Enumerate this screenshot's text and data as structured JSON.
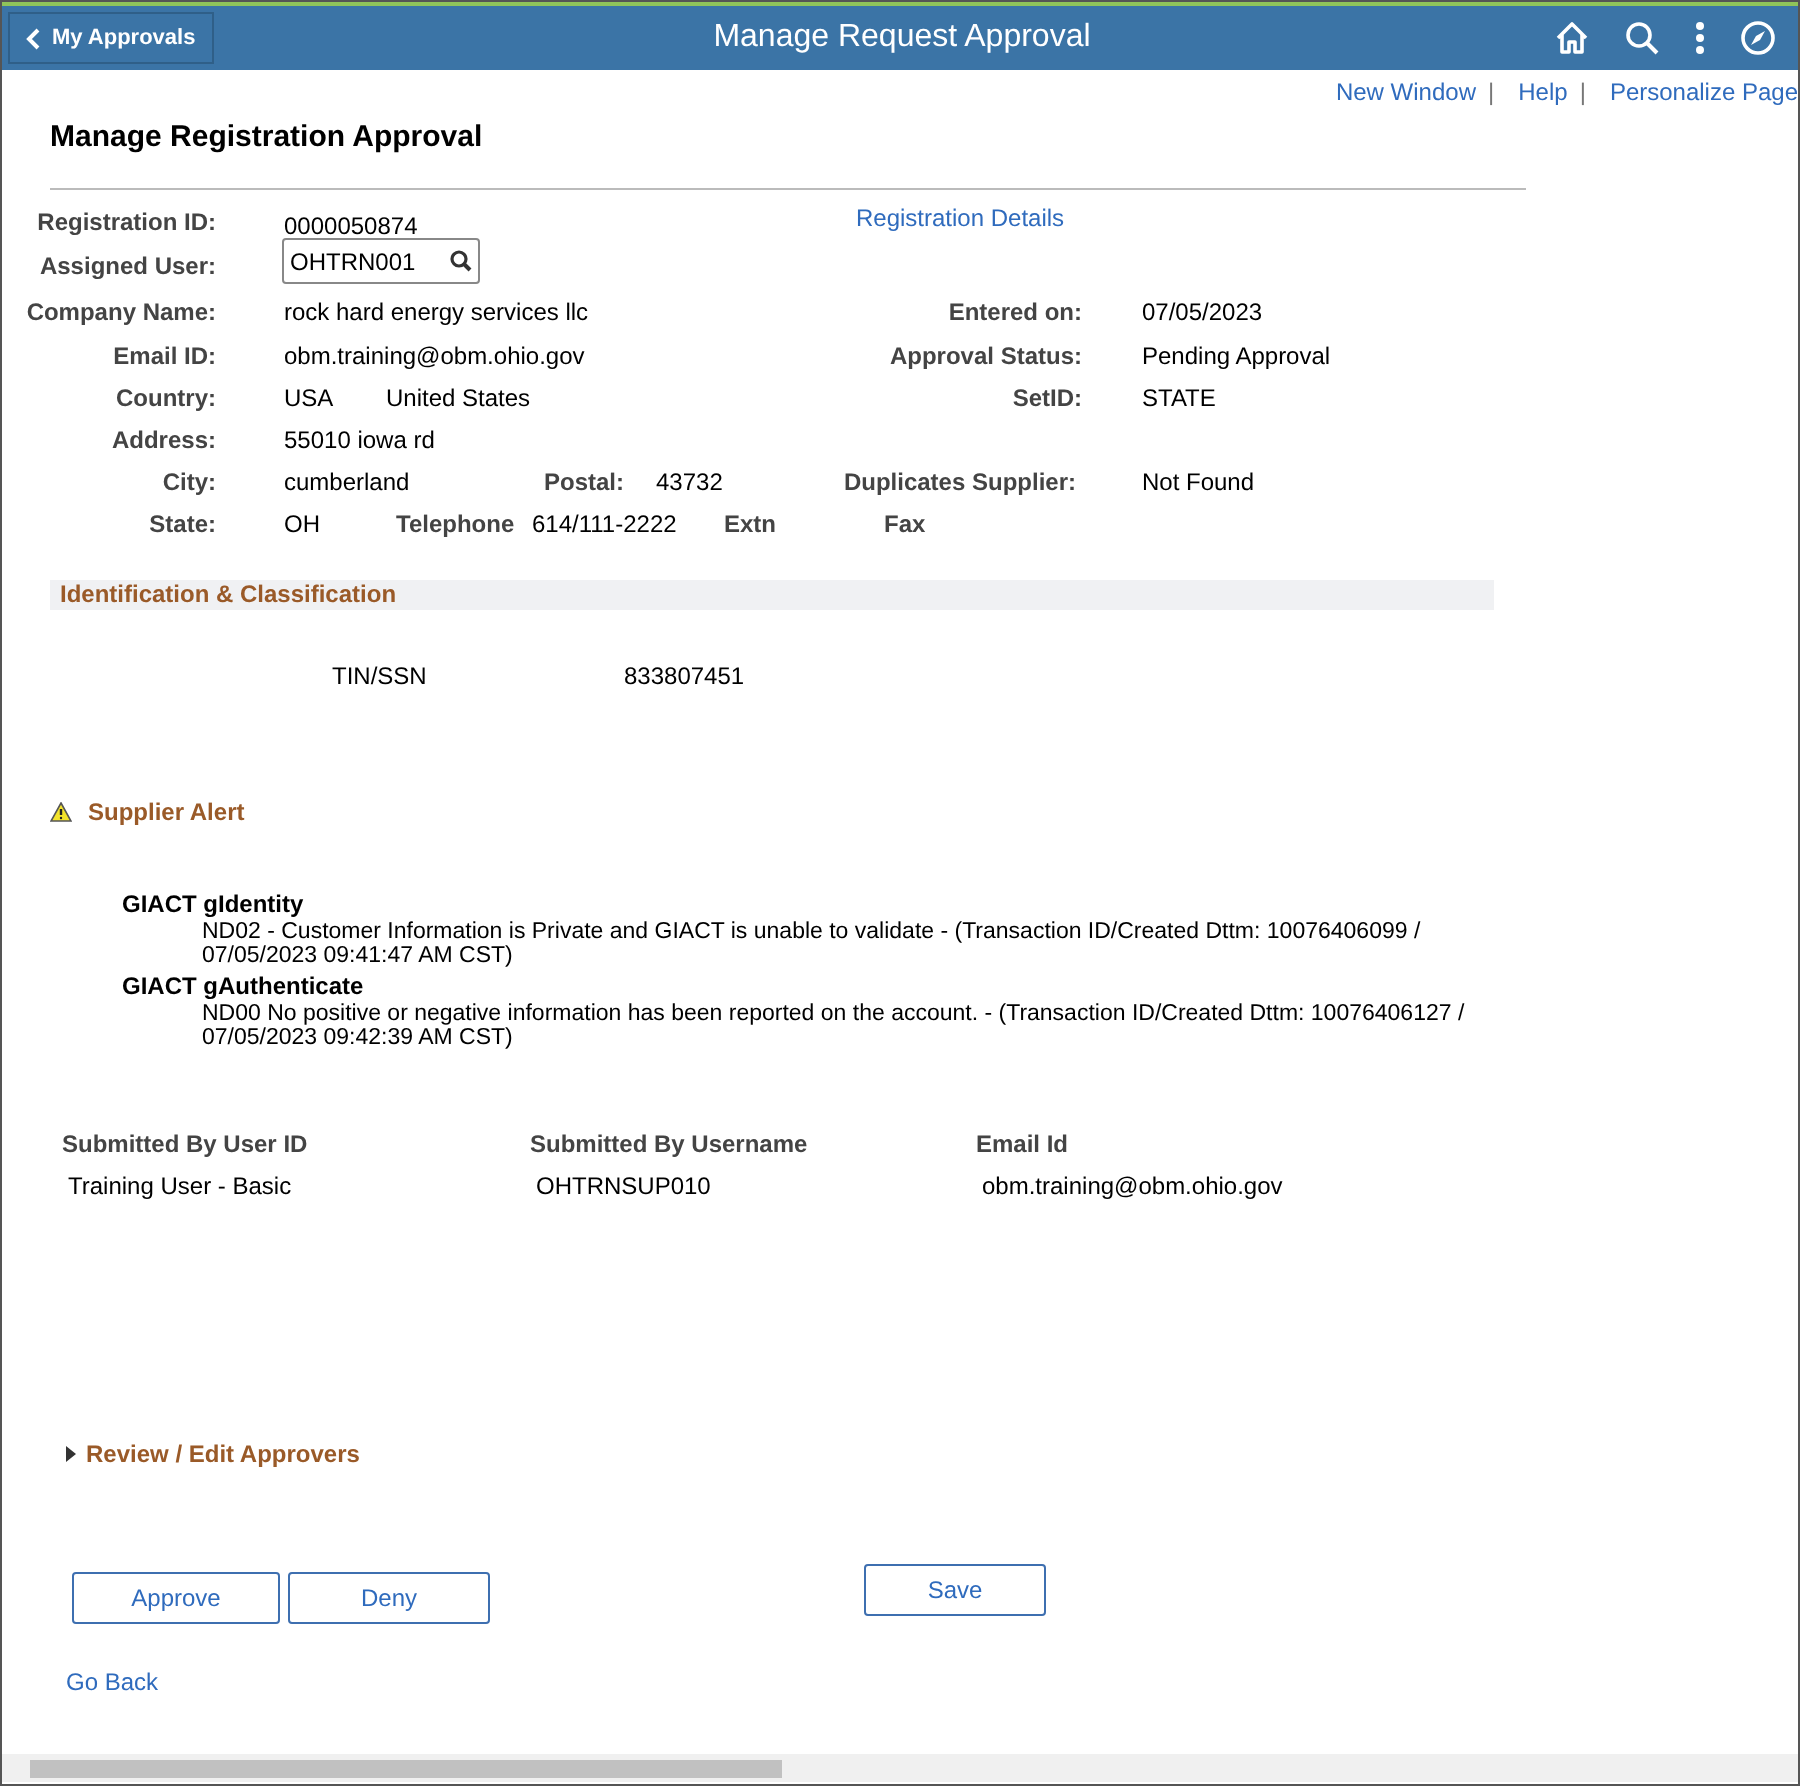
{
  "header": {
    "back_label": "My Approvals",
    "title": "Manage Request Approval"
  },
  "top_links": [
    {
      "label": "New Window",
      "separator": "|"
    },
    {
      "label": "Help",
      "separator": "|"
    },
    {
      "label": "Personalize Page"
    }
  ],
  "page_title": "Manage Registration Approval",
  "details": {
    "registration_id": {
      "label": "Registration ID:",
      "value": "0000050874"
    },
    "registration_details_link": "Registration Details",
    "assigned_user": {
      "label": "Assigned User:",
      "value": "OHTRN001"
    },
    "company_name": {
      "label": "Company Name:",
      "value": "rock hard energy services llc"
    },
    "entered_on": {
      "label": "Entered on:",
      "value": "07/05/2023"
    },
    "email_id": {
      "label": "Email ID:",
      "value": "obm.training@obm.ohio.gov"
    },
    "approval_status": {
      "label": "Approval Status:",
      "value": "Pending Approval"
    },
    "country": {
      "label": "Country:",
      "code": "USA",
      "name": "United States"
    },
    "setid": {
      "label": "SetID:",
      "value": "STATE"
    },
    "address": {
      "label": "Address:",
      "value": "55010 iowa rd"
    },
    "city": {
      "label": "City:",
      "value": "cumberland"
    },
    "postal": {
      "label": "Postal:",
      "value": "43732"
    },
    "duplicates_supplier": {
      "label": "Duplicates Supplier:",
      "value": "Not Found"
    },
    "state": {
      "label": "State:",
      "value": "OH"
    },
    "telephone": {
      "label": "Telephone",
      "value": "614/111-2222"
    },
    "extn": {
      "label": "Extn"
    },
    "fax": {
      "label": "Fax"
    }
  },
  "identification": {
    "title": "Identification & Classification",
    "label": "TIN/SSN",
    "value": "833807451"
  },
  "supplier_alert": {
    "title": "Supplier Alert",
    "alerts": [
      {
        "name": "GIACT gIdentity",
        "message": "ND02 - Customer Information is Private and GIACT is unable to validate - (Transaction ID/Created Dttm: 10076406099 / 07/05/2023 09:41:47 AM CST)"
      },
      {
        "name": "GIACT gAuthenticate",
        "message": "ND00 No positive or negative information has been reported on the account. - (Transaction ID/Created Dttm: 10076406127 / 07/05/2023 09:42:39 AM CST)"
      }
    ]
  },
  "submitted": {
    "columns": [
      "Submitted By User ID",
      "Submitted By Username",
      "Email Id"
    ],
    "row": [
      "Training User - Basic",
      "OHTRNSUP010",
      "obm.training@obm.ohio.gov"
    ]
  },
  "review_section": {
    "title": "Review / Edit Approvers",
    "expanded": false
  },
  "buttons": [
    "Approve",
    "Deny"
  ],
  "save_button": "Save",
  "go_back": "Go Back"
}
